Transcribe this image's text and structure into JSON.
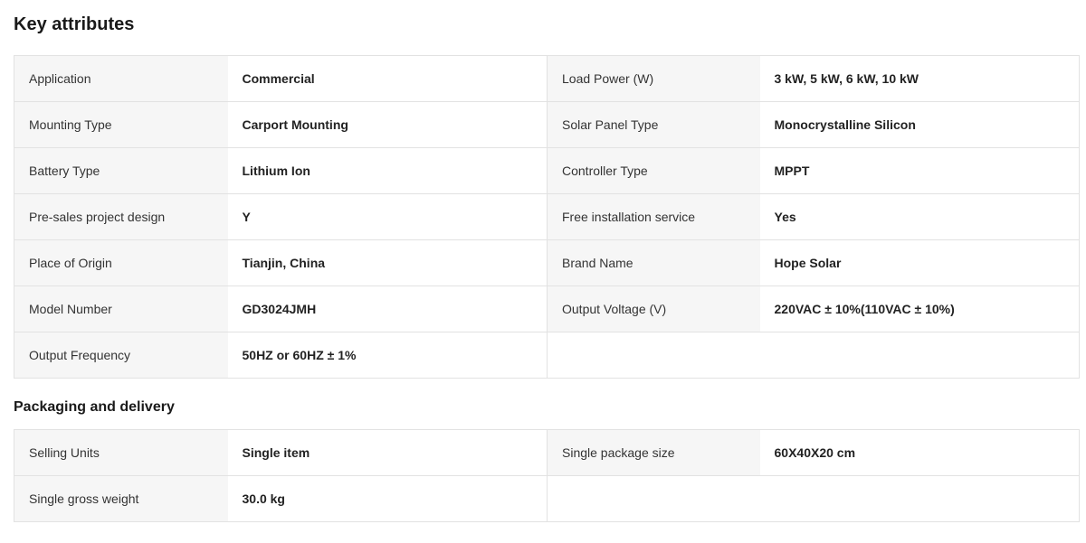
{
  "key_attributes": {
    "title": "Key attributes",
    "rows": [
      [
        {
          "label": "Application",
          "value": "Commercial"
        },
        {
          "label": "Load Power (W)",
          "value": "3 kW, 5 kW, 6 kW, 10 kW"
        }
      ],
      [
        {
          "label": "Mounting Type",
          "value": "Carport Mounting"
        },
        {
          "label": "Solar Panel Type",
          "value": "Monocrystalline Silicon"
        }
      ],
      [
        {
          "label": "Battery Type",
          "value": "Lithium Ion"
        },
        {
          "label": "Controller Type",
          "value": "MPPT"
        }
      ],
      [
        {
          "label": "Pre-sales project design",
          "value": "Y"
        },
        {
          "label": "Free installation service",
          "value": "Yes"
        }
      ],
      [
        {
          "label": "Place of Origin",
          "value": "Tianjin, China"
        },
        {
          "label": "Brand Name",
          "value": "Hope Solar"
        }
      ],
      [
        {
          "label": "Model Number",
          "value": "GD3024JMH"
        },
        {
          "label": "Output Voltage (V)",
          "value": "220VAC ± 10%(110VAC ± 10%)"
        }
      ],
      [
        {
          "label": "Output Frequency",
          "value": "50HZ or 60HZ ± 1%"
        }
      ]
    ]
  },
  "packaging": {
    "title": "Packaging and delivery",
    "rows": [
      [
        {
          "label": "Selling Units",
          "value": "Single item"
        },
        {
          "label": "Single package size",
          "value": "60X40X20 cm"
        }
      ],
      [
        {
          "label": "Single gross weight",
          "value": "30.0 kg"
        }
      ]
    ]
  }
}
